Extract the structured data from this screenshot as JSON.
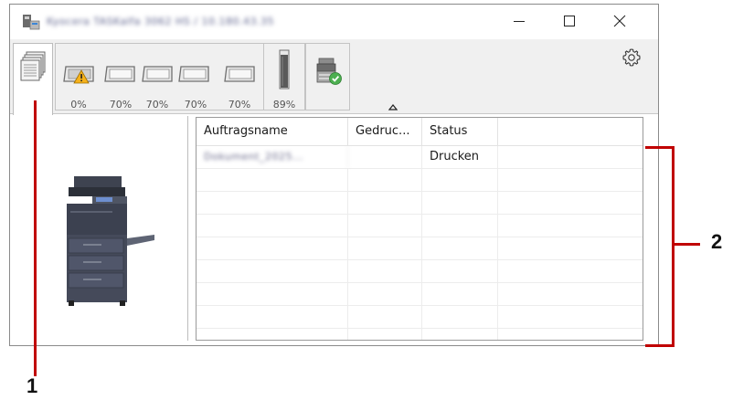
{
  "window": {
    "title": "Kyocera TASKalfa 3062 HS / 10.180.43.35",
    "minimize_icon": "minimize-icon",
    "maximize_icon": "maximize-icon",
    "close_icon": "close-icon"
  },
  "toolbar": {
    "jobs_tab_icon": "stacked-pages-icon",
    "trays": [
      {
        "icon": "paper-tray-warning-icon",
        "level": "0%"
      },
      {
        "icon": "paper-tray-icon",
        "level": "70%"
      },
      {
        "icon": "paper-tray-icon",
        "level": "70%"
      },
      {
        "icon": "paper-tray-icon",
        "level": "70%"
      },
      {
        "icon": "paper-tray-icon",
        "level": "70%"
      }
    ],
    "toner": {
      "icon": "toner-icon",
      "level": "89%"
    },
    "device_icon": "device-ok-icon",
    "collapse_icon": "collapse-up-icon",
    "settings_icon": "gear-icon"
  },
  "jobs_table": {
    "columns": [
      "Auftragsname",
      "Gedruc...",
      "Status"
    ],
    "rows": [
      {
        "name": "Dokument_2025...",
        "printed": "",
        "status": "Drucken"
      }
    ]
  },
  "callouts": [
    "1",
    "2"
  ],
  "colors": {
    "callout_line": "#c00000",
    "window_border": "#8a8a8a",
    "toolbar_bg": "#f0f0f0"
  }
}
